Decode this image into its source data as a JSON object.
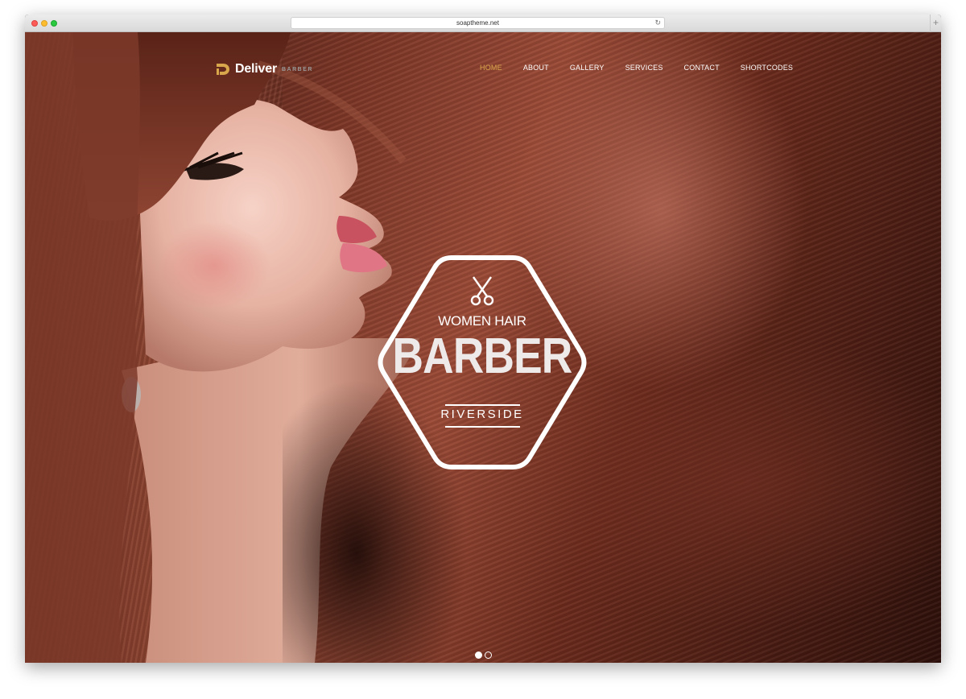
{
  "browser": {
    "url": "soaptheme.net"
  },
  "site": {
    "logo_text": "Deliver",
    "logo_sub": "BARBER",
    "brand_color": "#d8a64b"
  },
  "nav": {
    "items": [
      {
        "label": "HOME",
        "active": true
      },
      {
        "label": "ABOUT",
        "active": false
      },
      {
        "label": "GALLERY",
        "active": false
      },
      {
        "label": "SERVICES",
        "active": false
      },
      {
        "label": "CONTACT",
        "active": false
      },
      {
        "label": "SHORTCODES",
        "active": false
      }
    ]
  },
  "hero": {
    "subtitle": "WOMEN HAIR",
    "title": "BARBER",
    "location": "RIVERSIDE",
    "icon": "scissors-icon"
  },
  "slider": {
    "slides": 2,
    "active_index": 0
  }
}
